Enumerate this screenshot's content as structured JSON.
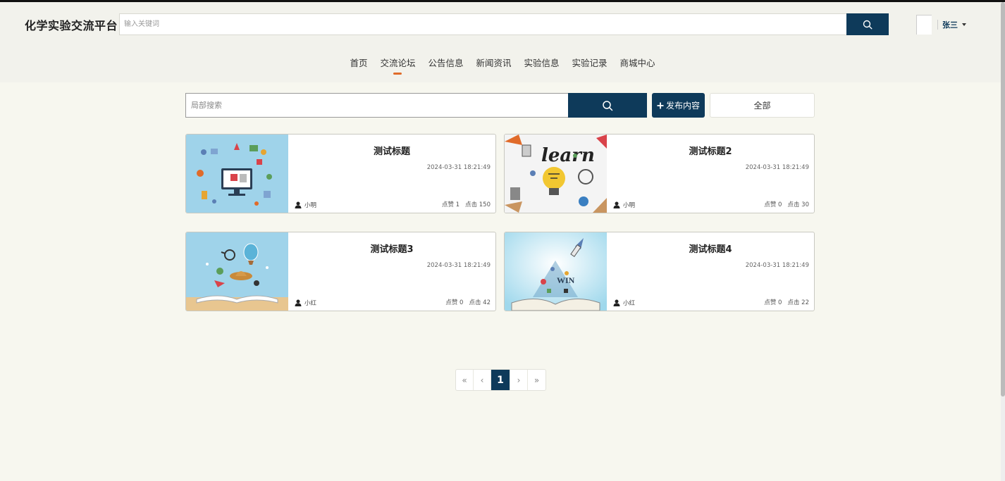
{
  "header": {
    "site_title": "化学实验交流平台",
    "search_placeholder": "输入关键词",
    "user_name": "张三"
  },
  "nav": {
    "items": [
      {
        "label": "首页"
      },
      {
        "label": "交流论坛"
      },
      {
        "label": "公告信息"
      },
      {
        "label": "新闻资讯"
      },
      {
        "label": "实验信息"
      },
      {
        "label": "实验记录"
      },
      {
        "label": "商城中心"
      }
    ],
    "active_index": 1
  },
  "toolbar": {
    "local_search_placeholder": "局部搜索",
    "publish_label": "发布内容",
    "all_label": "全部"
  },
  "posts": [
    {
      "title": "测试标题",
      "date": "2024-03-31 18:21:49",
      "author": "小明",
      "likes": "点赞 1",
      "clicks": "点击 150"
    },
    {
      "title": "测试标题2",
      "date": "2024-03-31 18:21:49",
      "author": "小明",
      "likes": "点赞 0",
      "clicks": "点击 30"
    },
    {
      "title": "测试标题3",
      "date": "2024-03-31 18:21:49",
      "author": "小红",
      "likes": "点赞 0",
      "clicks": "点击 42"
    },
    {
      "title": "测试标题4",
      "date": "2024-03-31 18:21:49",
      "author": "小红",
      "likes": "点赞 0",
      "clicks": "点击 22"
    }
  ],
  "pagination": {
    "first": "«",
    "prev": "‹",
    "current": "1",
    "next": "›",
    "last": "»"
  },
  "colors": {
    "primary": "#0e3a5a",
    "accent": "#e06b2a",
    "page_bg": "#f7f7ef"
  }
}
